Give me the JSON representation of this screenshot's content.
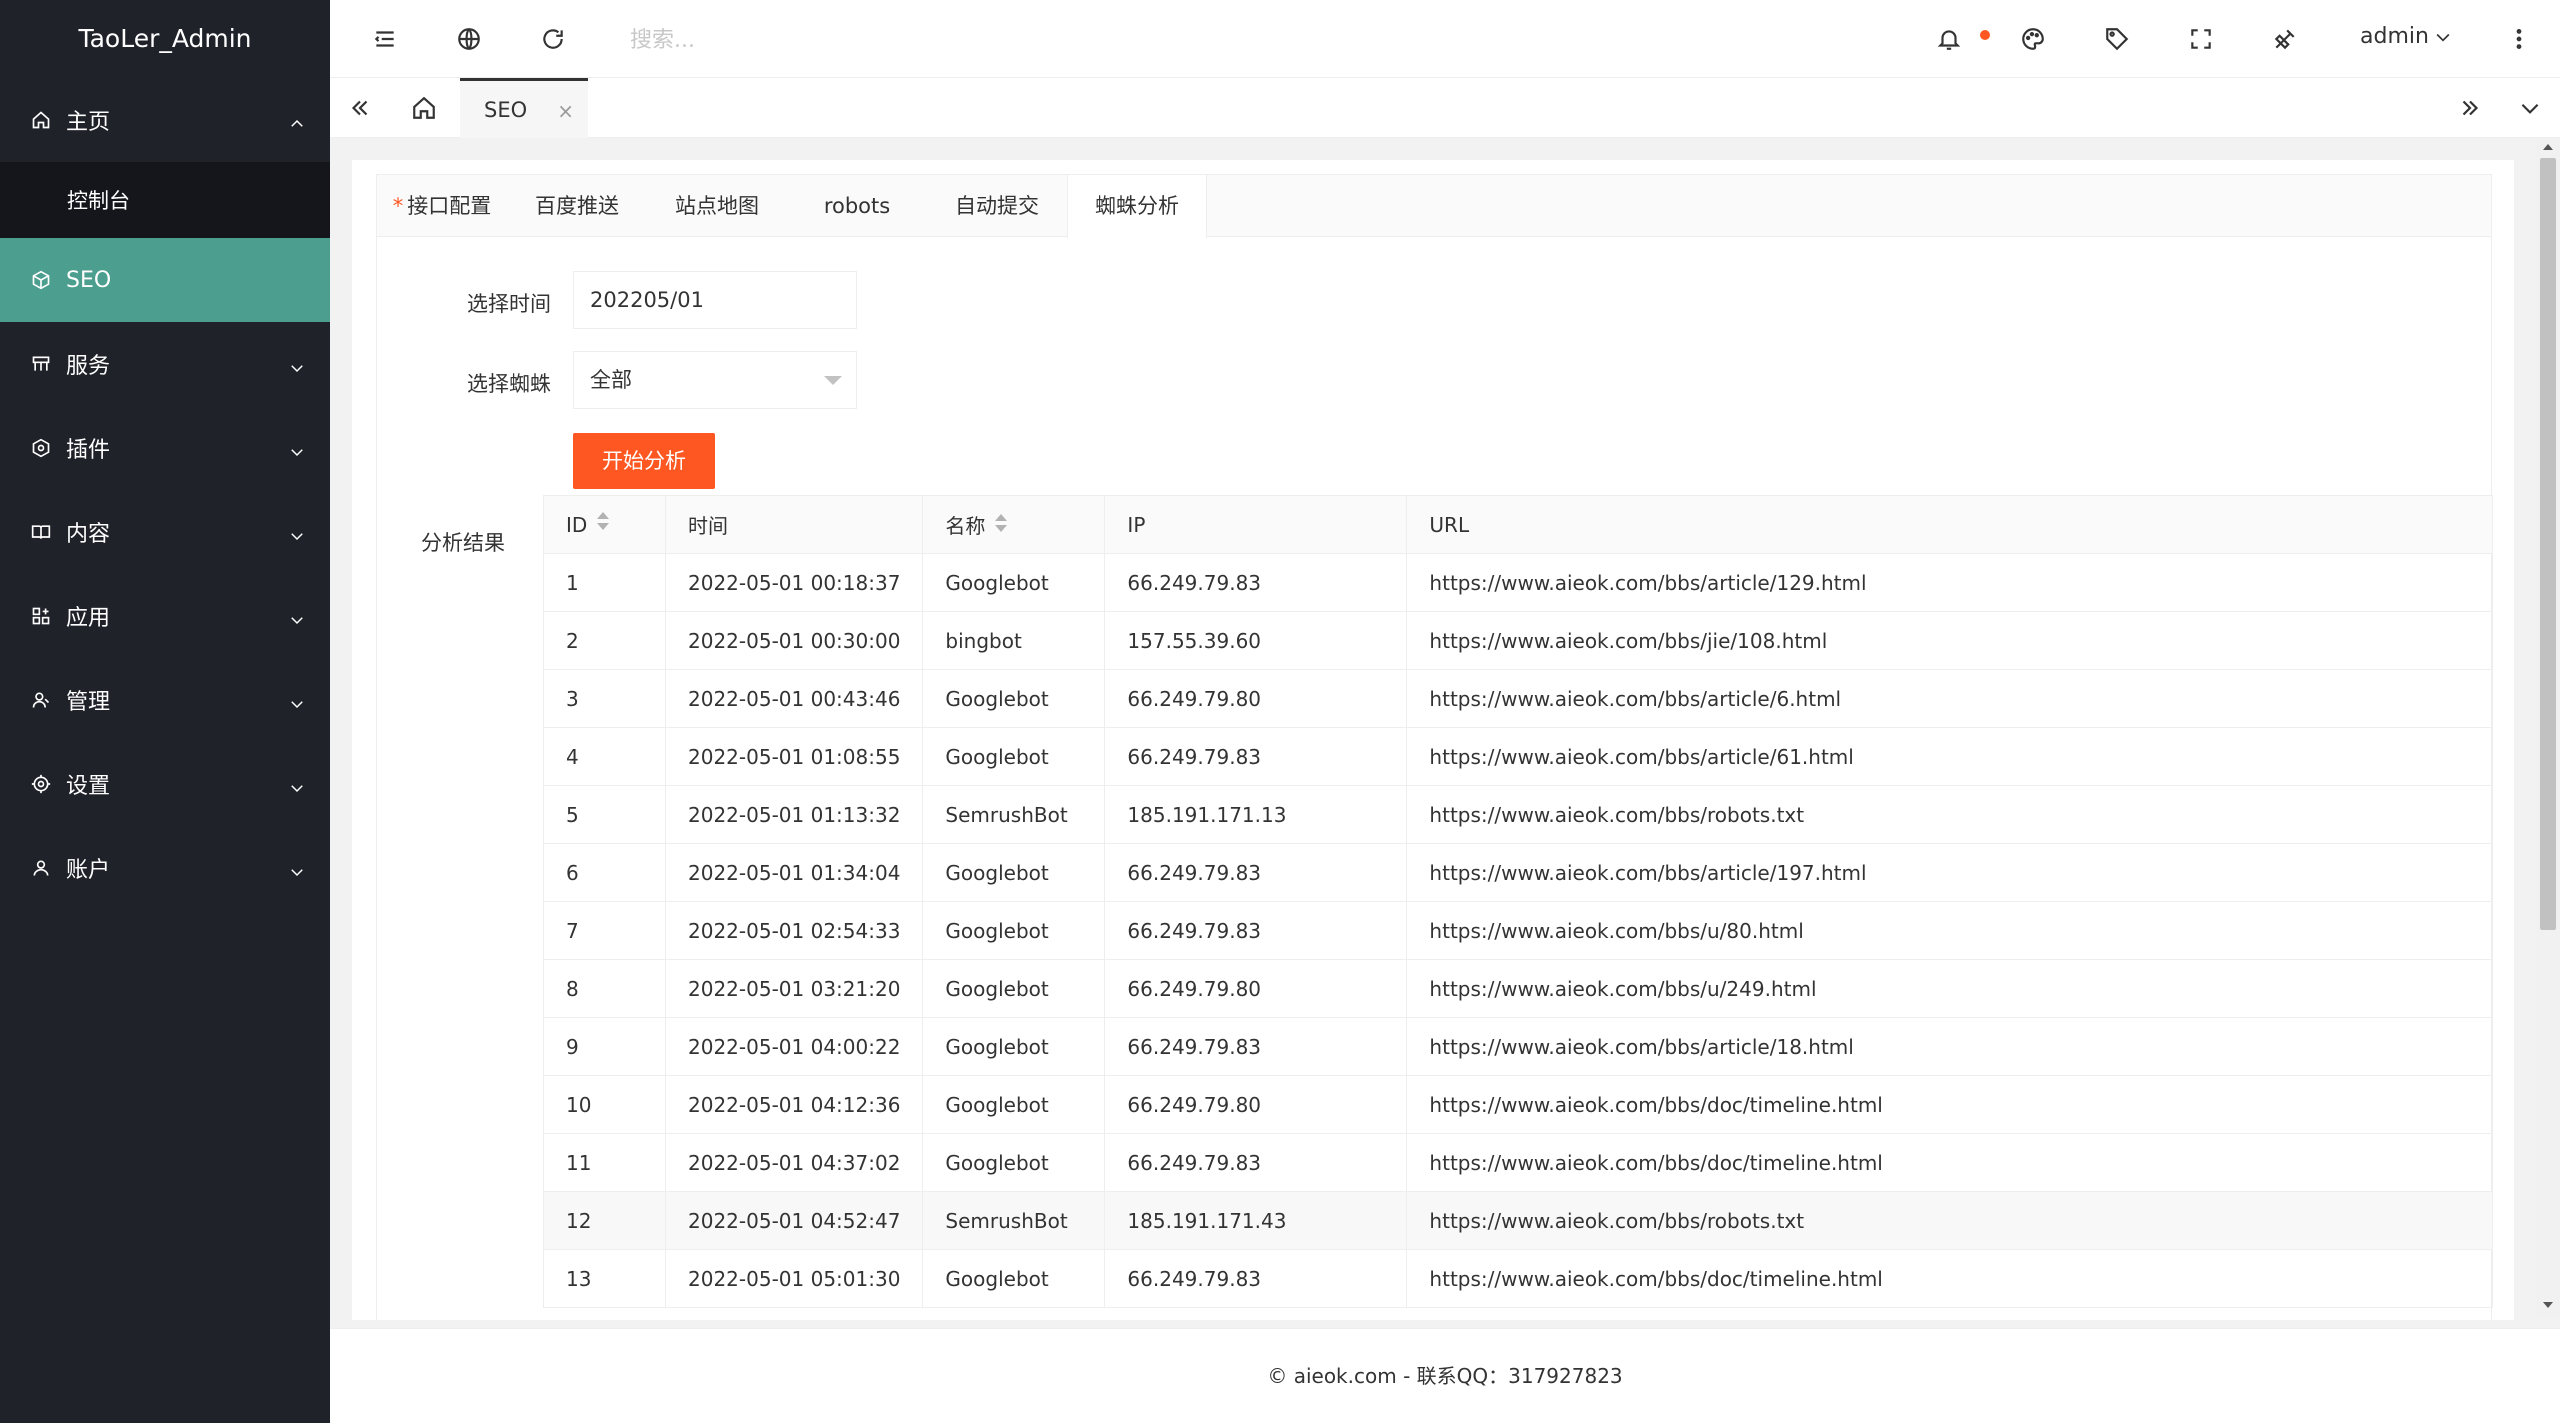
{
  "app": {
    "title": "TaoLer_Admin"
  },
  "sidebar": {
    "items": [
      {
        "label": "主页",
        "icon": "home-icon",
        "expanded": true
      },
      {
        "label": "控制台"
      },
      {
        "label": "SEO",
        "icon": "seo-icon",
        "active": true
      },
      {
        "label": "服务",
        "icon": "service-icon"
      },
      {
        "label": "插件",
        "icon": "plugin-icon"
      },
      {
        "label": "内容",
        "icon": "content-icon"
      },
      {
        "label": "应用",
        "icon": "app-icon"
      },
      {
        "label": "管理",
        "icon": "manage-icon"
      },
      {
        "label": "设置",
        "icon": "settings-icon"
      },
      {
        "label": "账户",
        "icon": "account-icon"
      }
    ]
  },
  "header": {
    "search_placeholder": "搜索...",
    "user": "admin"
  },
  "tabbar": {
    "current_tab": "SEO",
    "close": "×"
  },
  "seo": {
    "tabs": [
      "接口配置",
      "百度推送",
      "站点地图",
      "robots",
      "自动提交",
      "蜘蛛分析"
    ],
    "active_tab": "蜘蛛分析",
    "required_mark": "*",
    "time_label": "选择时间",
    "time_value": "202205/01",
    "spider_label": "选择蜘蛛",
    "spider_value": "全部",
    "analyze_button": "开始分析",
    "result_label": "分析结果",
    "columns": [
      "ID",
      "时间",
      "名称",
      "IP",
      "URL"
    ],
    "rows": [
      [
        "1",
        "2022-05-01 00:18:37",
        "Googlebot",
        "66.249.79.83",
        "https://www.aieok.com/bbs/article/129.html"
      ],
      [
        "2",
        "2022-05-01 00:30:00",
        "bingbot",
        "157.55.39.60",
        "https://www.aieok.com/bbs/jie/108.html"
      ],
      [
        "3",
        "2022-05-01 00:43:46",
        "Googlebot",
        "66.249.79.80",
        "https://www.aieok.com/bbs/article/6.html"
      ],
      [
        "4",
        "2022-05-01 01:08:55",
        "Googlebot",
        "66.249.79.83",
        "https://www.aieok.com/bbs/article/61.html"
      ],
      [
        "5",
        "2022-05-01 01:13:32",
        "SemrushBot",
        "185.191.171.13",
        "https://www.aieok.com/bbs/robots.txt"
      ],
      [
        "6",
        "2022-05-01 01:34:04",
        "Googlebot",
        "66.249.79.83",
        "https://www.aieok.com/bbs/article/197.html"
      ],
      [
        "7",
        "2022-05-01 02:54:33",
        "Googlebot",
        "66.249.79.83",
        "https://www.aieok.com/bbs/u/80.html"
      ],
      [
        "8",
        "2022-05-01 03:21:20",
        "Googlebot",
        "66.249.79.80",
        "https://www.aieok.com/bbs/u/249.html"
      ],
      [
        "9",
        "2022-05-01 04:00:22",
        "Googlebot",
        "66.249.79.83",
        "https://www.aieok.com/bbs/article/18.html"
      ],
      [
        "10",
        "2022-05-01 04:12:36",
        "Googlebot",
        "66.249.79.80",
        "https://www.aieok.com/bbs/doc/timeline.html"
      ],
      [
        "11",
        "2022-05-01 04:37:02",
        "Googlebot",
        "66.249.79.83",
        "https://www.aieok.com/bbs/doc/timeline.html"
      ],
      [
        "12",
        "2022-05-01 04:52:47",
        "SemrushBot",
        "185.191.171.43",
        "https://www.aieok.com/bbs/robots.txt"
      ],
      [
        "13",
        "2022-05-01 05:01:30",
        "Googlebot",
        "66.249.79.83",
        "https://www.aieok.com/bbs/doc/timeline.html"
      ]
    ]
  },
  "footer": {
    "text": "© aieok.com - 联系QQ：317927823"
  },
  "colors": {
    "sidebar_bg": "#20222a",
    "active_nav": "#4c9e8f",
    "accent": "#ff5722"
  }
}
